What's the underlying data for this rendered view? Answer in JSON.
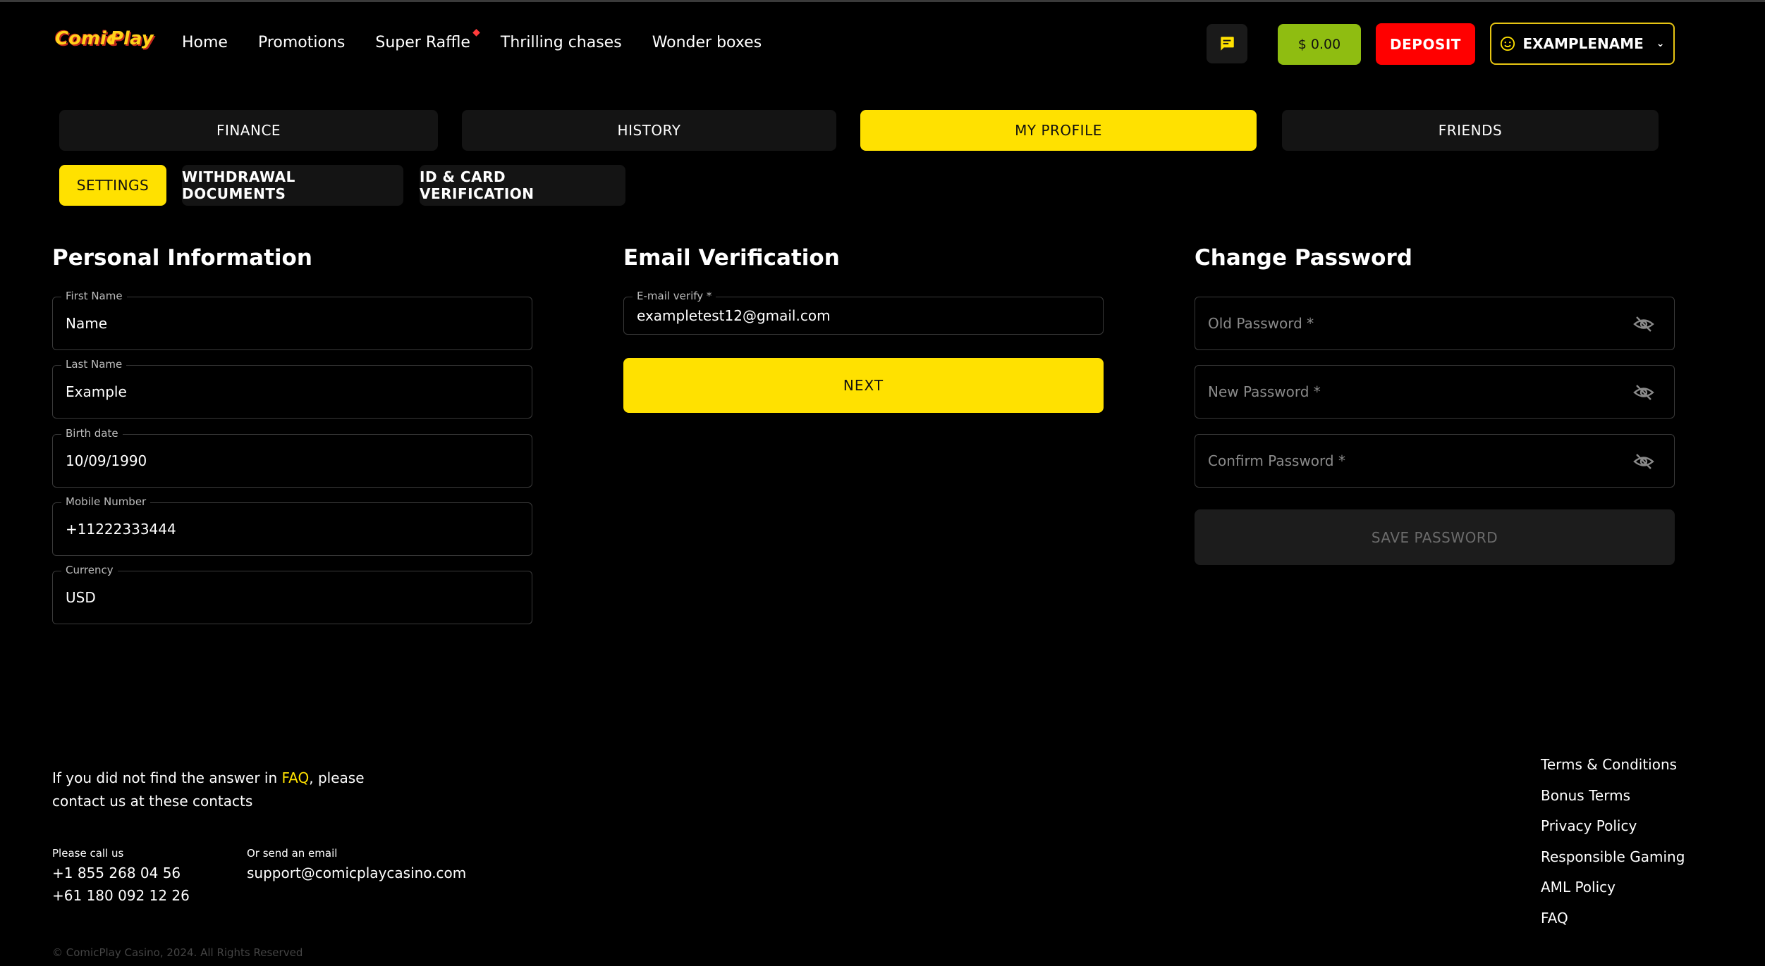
{
  "header": {
    "logo_word1": "Comic",
    "logo_word2": "Play",
    "nav": [
      {
        "label": "Home"
      },
      {
        "label": "Promotions"
      },
      {
        "label": "Super Raffle"
      },
      {
        "label": "Thrilling chases"
      },
      {
        "label": "Wonder boxes"
      }
    ],
    "balance": "$ 0.00",
    "deposit_label": "DEPOSIT",
    "username": "EXAMPLENAME",
    "colors": {
      "accent": "#ffe100",
      "balance": "#8fbd11",
      "deposit": "#ff0000"
    }
  },
  "tabs": [
    {
      "label": "FINANCE"
    },
    {
      "label": "HISTORY"
    },
    {
      "label": "MY PROFILE"
    },
    {
      "label": "FRIENDS"
    }
  ],
  "subtabs": [
    {
      "label": "SETTINGS"
    },
    {
      "label": "WITHDRAWAL DOCUMENTS"
    },
    {
      "label": "ID & CARD VERIFICATION"
    }
  ],
  "personal": {
    "title": "Personal Information",
    "fields": [
      {
        "label": "First Name",
        "value": "Name"
      },
      {
        "label": "Last Name",
        "value": "Example"
      },
      {
        "label": "Birth date",
        "value": "10/09/1990"
      },
      {
        "label": "Mobile Number",
        "value": "+11222333444"
      },
      {
        "label": "Currency",
        "value": "USD"
      }
    ]
  },
  "email": {
    "title": "Email Verification",
    "label": "E-mail verify *",
    "value": "exampletest12@gmail.com",
    "next_label": "NEXT"
  },
  "password": {
    "title": "Change Password",
    "old_placeholder": "Old Password *",
    "new_placeholder": "New Password *",
    "confirm_placeholder": "Confirm Password *",
    "save_label": "SAVE PASSWORD"
  },
  "footer": {
    "help_prefix": "If you did not find the answer in ",
    "help_faq": "FAQ",
    "help_suffix": ", please contact us at these contacts",
    "call_label": "Please call us",
    "phone1": "+1 855 268 04 56",
    "phone2": "+61 180 092 12 26",
    "email_label": "Or send an email",
    "email": "support@comicplaycasino.com",
    "links": [
      {
        "label": "Terms & Conditions"
      },
      {
        "label": "Bonus Terms"
      },
      {
        "label": "Privacy Policy"
      },
      {
        "label": "Responsible Gaming"
      },
      {
        "label": "AML Policy"
      },
      {
        "label": "FAQ"
      }
    ],
    "copyright": "© ComicPlay Casino, 2024. All Rights Reserved"
  }
}
